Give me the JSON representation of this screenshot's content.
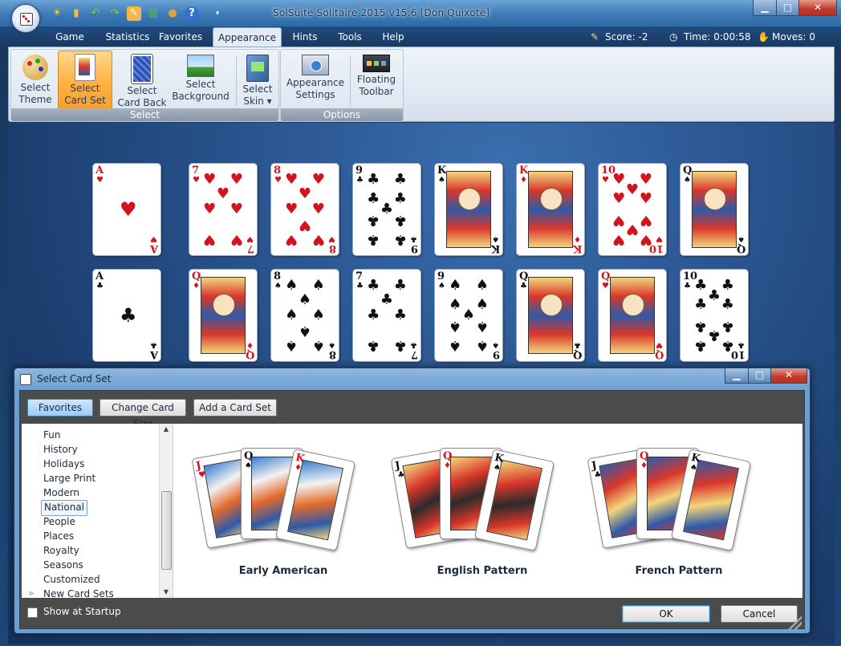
{
  "window": {
    "title": "SolSuite Solitaire 2015 v15.6  [Don Quixote]",
    "minimize": "▁",
    "maximize": "□",
    "close": "✕"
  },
  "menu": {
    "tabs": [
      "Game",
      "Statistics",
      "Favorites",
      "Appearance",
      "Hints",
      "Tools",
      "Help"
    ],
    "active_tab": "Appearance"
  },
  "status": {
    "score_label": "Score:",
    "score_value": "-2",
    "time_label": "Time:",
    "time_value": "0:00:58",
    "moves_label": "Moves:",
    "moves_value": "0"
  },
  "ribbon": {
    "select_group_label": "Select",
    "options_group_label": "Options",
    "buttons": {
      "select_theme": "Select Theme",
      "select_card_set": "Select Card Set",
      "select_card_back": "Select Card Back",
      "select_background": "Select Background",
      "select_skin": "Select Skin ▾",
      "appearance_settings": "Appearance Settings",
      "floating_toolbar": "Floating Toolbar"
    }
  },
  "tableau": {
    "row1": [
      {
        "rank": "A",
        "suit": "♥",
        "color": "red"
      },
      {
        "rank": "7",
        "suit": "♥",
        "color": "red"
      },
      {
        "rank": "8",
        "suit": "♥",
        "color": "red"
      },
      {
        "rank": "9",
        "suit": "♣",
        "color": "black"
      },
      {
        "rank": "K",
        "suit": "♠",
        "color": "black"
      },
      {
        "rank": "K",
        "suit": "♦",
        "color": "red"
      },
      {
        "rank": "10",
        "suit": "♥",
        "color": "red"
      },
      {
        "rank": "Q",
        "suit": "♠",
        "color": "black"
      }
    ],
    "row2": [
      {
        "rank": "A",
        "suit": "♣",
        "color": "black"
      },
      {
        "rank": "Q",
        "suit": "♦",
        "color": "red"
      },
      {
        "rank": "8",
        "suit": "♠",
        "color": "black"
      },
      {
        "rank": "7",
        "suit": "♣",
        "color": "black"
      },
      {
        "rank": "9",
        "suit": "♠",
        "color": "black"
      },
      {
        "rank": "Q",
        "suit": "♣",
        "color": "black"
      },
      {
        "rank": "Q",
        "suit": "♥",
        "color": "red"
      },
      {
        "rank": "10",
        "suit": "♣",
        "color": "black"
      }
    ]
  },
  "dialog": {
    "title": "Select Card Set",
    "toolbar": {
      "favorites": "Favorites",
      "change_card_size": "Change Card Size",
      "add_card_set": "Add a Card Set"
    },
    "categories": [
      "Fun",
      "History",
      "Holidays",
      "Large Print",
      "Modern",
      "National",
      "People",
      "Places",
      "Royalty",
      "Seasons",
      "Customized",
      "New Card Sets"
    ],
    "selected_category": "National",
    "card_sets": [
      {
        "name": "Early American",
        "cards": [
          {
            "rank": "J",
            "suit": "♥"
          },
          {
            "rank": "Q",
            "suit": "♠"
          },
          {
            "rank": "K",
            "suit": "♦"
          }
        ]
      },
      {
        "name": "English Pattern",
        "cards": [
          {
            "rank": "J",
            "suit": "♣"
          },
          {
            "rank": "Q",
            "suit": "♦"
          },
          {
            "rank": "K",
            "suit": "♠"
          }
        ]
      },
      {
        "name": "French Pattern",
        "cards": [
          {
            "rank": "J",
            "suit": "♣"
          },
          {
            "rank": "Q",
            "suit": "♦"
          },
          {
            "rank": "K",
            "suit": "♠"
          }
        ]
      }
    ],
    "show_at_startup": "Show at Startup",
    "ok": "OK",
    "cancel": "Cancel"
  }
}
